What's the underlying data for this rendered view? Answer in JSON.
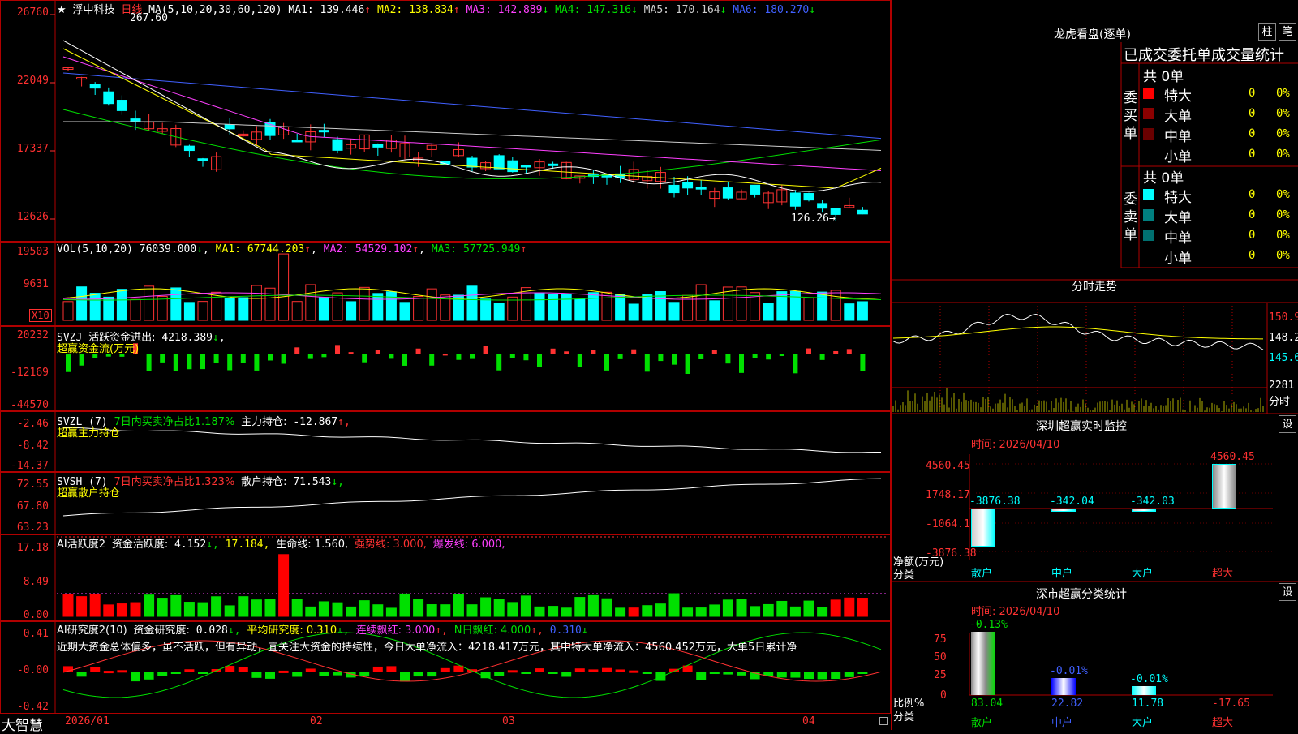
{
  "stock": {
    "star": "★",
    "name": "浮中科技",
    "period": "日线"
  },
  "ma_line": {
    "params": "MA(5,10,20,30,60,120)",
    "items": [
      {
        "label": "MA1:",
        "value": "139.446",
        "arrow": "↑",
        "color": "#ffffff"
      },
      {
        "label": "MA2:",
        "value": "138.834",
        "arrow": "↑",
        "color": "#ffff00"
      },
      {
        "label": "MA3:",
        "value": "142.889",
        "arrow": "↓",
        "color": "#ff40ff"
      },
      {
        "label": "MA4:",
        "value": "147.316",
        "arrow": "↓",
        "color": "#00e000"
      },
      {
        "label": "MA5:",
        "value": "170.164",
        "arrow": "↓",
        "color": "#cccccc"
      },
      {
        "label": "MA6:",
        "value": "180.270",
        "arrow": "↓",
        "color": "#4060ff"
      }
    ]
  },
  "price_axis": [
    "26760",
    "22049",
    "17337",
    "12626"
  ],
  "price_marks": {
    "high": "267.60",
    "low": "126.26"
  },
  "vol": {
    "params": "VOL(5,10,20)",
    "value": "76039.000",
    "arrow": "↓",
    "ma1": "MA1: 67744.203",
    "ma2": "MA2: 54529.102",
    "ma3": "MA3: 57725.949",
    "axis": [
      "19503",
      "9631"
    ],
    "unit": "X10"
  },
  "svzj": {
    "title": "SVZJ",
    "label": "活跃资金进出:",
    "value": "4218.389",
    "arrow": "↓",
    "sub": "超赢资金流(万元)",
    "axis": [
      "20232",
      "-12169",
      "-44570"
    ]
  },
  "svzl": {
    "title": "SVZL (7)",
    "label": "7日内买卖净占比1.187%",
    "label2": "主力持仓:",
    "value": "-12.867",
    "arrow": "↑,",
    "sub": "超赢主力持仓",
    "axis": [
      "-2.46",
      "-8.42",
      "-14.37"
    ]
  },
  "svsh": {
    "title": "SVSH (7)",
    "label": "7日内买卖净占比1.323%",
    "label2": "散户持仓:",
    "value": "71.543",
    "arrow": "↓,",
    "sub": "超赢散户持仓",
    "axis": [
      "72.55",
      "67.80",
      "63.23"
    ]
  },
  "ai_active": {
    "title": "AI活跃度2",
    "label": "资金活跃度:",
    "value": "4.152",
    "arrow": "↓,",
    "v2": "17.184,",
    "life": "生命线: 1.560,",
    "strong": "强势线: 3.000,",
    "burst": "爆发线: 6.000,",
    "axis": [
      "17.18",
      "8.49",
      "0.00"
    ]
  },
  "ai_research": {
    "title": "AI研究度2(10)",
    "label": "资金研究度:",
    "value": "0.028",
    "arrow": "↓,",
    "avg": "平均研究度: 0.310",
    "avg_arrow": "↓,",
    "red3": "连续飘红: 3.000",
    "red3_arrow": "↑,",
    "nred": "N日飘红: 4.000",
    "nred_arrow": "↑,",
    "last": "0.310",
    "last_arrow": "↓",
    "comment": "近期大资金总体偏多，虽不活跃，但有异动，宜关注大资金的持续性，今日大单净流入：4218.417万元，其中特大单净流入：4560.452万元，大单5日累计净",
    "axis": [
      "0.41",
      "-0.00",
      "-0.42"
    ]
  },
  "x_axis": [
    "2026/01",
    "02",
    "03",
    "04"
  ],
  "brand": "大智慧",
  "right": {
    "top_title": "龙虎看盘(逐单)",
    "btn1": "柱",
    "btn2": "笔",
    "stats_title": "已成交委托单成交量统计",
    "buy_side": "委买单",
    "buy_total": "共 0单",
    "sell_side": "委卖单",
    "sell_total": "共 0单",
    "rows": [
      {
        "name": "特大",
        "count": "0",
        "pct": "0%",
        "color": "#ff0000"
      },
      {
        "name": "大单",
        "count": "0",
        "pct": "0%",
        "color": "#8b0000"
      },
      {
        "name": "中单",
        "count": "0",
        "pct": "0%",
        "color": "#6a0000"
      },
      {
        "name": "小单",
        "count": "0",
        "pct": "0%",
        "color": "#000000"
      }
    ],
    "sell_rows": [
      {
        "name": "特大",
        "count": "0",
        "pct": "0%",
        "color": "#00ffff"
      },
      {
        "name": "大单",
        "count": "0",
        "pct": "0%",
        "color": "#008080"
      },
      {
        "name": "中单",
        "count": "0",
        "pct": "0%",
        "color": "#007070"
      },
      {
        "name": "小单",
        "count": "0",
        "pct": "0%",
        "color": "#000000"
      }
    ],
    "intraday_title": "分时走势",
    "intraday_axis": [
      "150.9",
      "148.2",
      "145.6"
    ],
    "intraday_vol": "2281",
    "intraday_unit": "分时",
    "sz_title": "深圳超赢实时监控",
    "set1": "设",
    "time1": "时间: 2026/04/10",
    "sz_axis": [
      "4560.45",
      "1748.17",
      "-1064.1",
      "-3876.38"
    ],
    "sz_ylabel": "净额(万元)",
    "sz_xlabel": "分类",
    "sz_bars": [
      {
        "cat": "散户",
        "val": "-3876.38"
      },
      {
        "cat": "中户",
        "val": "-342.04"
      },
      {
        "cat": "大户",
        "val": "-342.03"
      },
      {
        "cat": "超大",
        "val": "4560.45"
      }
    ],
    "cls_title": "深市超赢分类统计",
    "set2": "设",
    "time2": "时间: 2026/04/10",
    "cls_axis": [
      "75",
      "50",
      "25",
      "0"
    ],
    "cls_ylabel": "比例%",
    "cls_xlabel": "分类",
    "cls_bars": [
      {
        "cat": "散户",
        "top": "-0.13%",
        "val": "83.04"
      },
      {
        "cat": "中户",
        "top": "-0.01%",
        "val": "22.82"
      },
      {
        "cat": "大户",
        "top": "-0.01%",
        "val": "11.78"
      },
      {
        "cat": "超大",
        "top": "",
        "val": "-17.65"
      }
    ]
  },
  "chart_data": {
    "type": "bar",
    "title": "深圳超赢实时监控",
    "categories": [
      "散户",
      "中户",
      "大户",
      "超大"
    ],
    "values": [
      -3876.38,
      -342.04,
      -342.03,
      4560.45
    ],
    "ylabel": "净额(万元)",
    "xlabel": "分类",
    "ylim": [
      -3876.38,
      4560.45
    ]
  }
}
